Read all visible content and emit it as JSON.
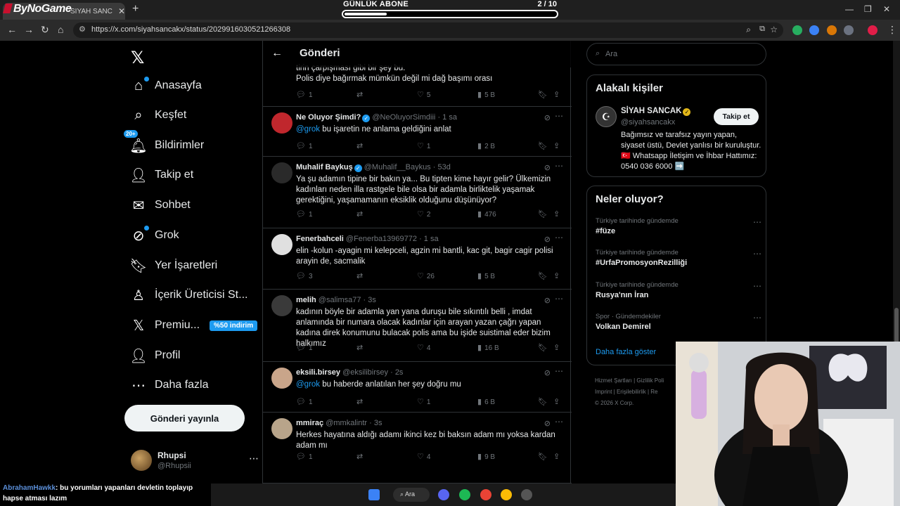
{
  "browser": {
    "logo": "ByNoGame",
    "tab_title": "SİYAH SANCAK: \"",
    "url": "https://x.com/siyahsancakx/status/2029916030521266308"
  },
  "overlay": {
    "label": "GÜNLÜK ABONE",
    "count": "2 / 10",
    "progress": 0.2
  },
  "sidebar": {
    "items": [
      {
        "label": "Anasayfa",
        "icon": "home-icon"
      },
      {
        "label": "Keşfet",
        "icon": "search-icon"
      },
      {
        "label": "Bildirimler",
        "icon": "bell-icon",
        "badge": "20+"
      },
      {
        "label": "Takip et",
        "icon": "follow-icon"
      },
      {
        "label": "Sohbet",
        "icon": "mail-icon"
      },
      {
        "label": "Grok",
        "icon": "grok-icon"
      },
      {
        "label": "Yer İşaretleri",
        "icon": "bookmark-icon"
      },
      {
        "label": "İçerik Üreticisi St...",
        "icon": "creator-icon"
      },
      {
        "label": "Premiu...",
        "icon": "x-premium-icon",
        "badge": "%50 indirim"
      },
      {
        "label": "Profil",
        "icon": "profile-icon"
      },
      {
        "label": "Daha fazla",
        "icon": "more-icon"
      }
    ],
    "post_button": "Gönderi yayınla",
    "profile": {
      "name": "Rhupsi",
      "handle": "@Rhupsii"
    }
  },
  "main": {
    "title": "Gönderi",
    "partial_text": "tirin çarpışması gibi bir şey bu.\nPolis diye bağırmak mümkün değil mi dağ başımı orası",
    "partial_stats": {
      "replies": "1",
      "likes": "5",
      "views": "5 B"
    },
    "replies": [
      {
        "name": "Ne Oluyor Şimdi?",
        "verified": true,
        "handle": "@NeOluyorSimdiii",
        "time": "1 sa",
        "mention": "@grok",
        "text": " bu işaretin ne anlama geldiğini anlat",
        "replies": "1",
        "retweets": "",
        "likes": "1",
        "views": "2 B",
        "avatar_color": "#c0272d"
      },
      {
        "name": "Muhalif Baykuş",
        "verified": true,
        "handle": "@Muhalif__Baykus",
        "time": "53d",
        "mention": "",
        "text": "Ya şu adamın tipine bir bakın ya... Bu tipten kime hayır gelir? Ülkemizin kadınları neden illa rastgele bile olsa bir adamla birliktelik yaşamak gerektiğini, yaşamamanın eksiklik olduğunu düşünüyor?",
        "replies": "1",
        "retweets": "",
        "likes": "2",
        "views": "476",
        "avatar_color": "#2a2a2a"
      },
      {
        "name": "Fenerbahceli",
        "verified": false,
        "handle": "@Fenerba13969772",
        "time": "1 sa",
        "mention": "",
        "text": "elin -kolun -ayagin mi kelepceli, agzin mi bantli, kac git, bagir cagir polisi arayin de, sacmalik",
        "replies": "3",
        "retweets": "",
        "likes": "26",
        "views": "5 B",
        "avatar_color": "#e0e0e0"
      },
      {
        "name": "melih",
        "verified": false,
        "handle": "@salimsa77",
        "time": "3s",
        "mention": "",
        "text": "kadının böyle bir  adamla yan yana duruşu bile sıkıntılı belli , imdat anlamında bir numara olacak kadınlar için arayan yazan çağrı yapan kadına direk konumunu bulacak polis ama bu işide suistimal eder bizim halkımız",
        "replies": "1",
        "retweets": "",
        "likes": "4",
        "views": "16 B",
        "avatar_color": "#3a3a3a"
      },
      {
        "name": "eksili.birsey",
        "verified": false,
        "handle": "@eksilibirsey",
        "time": "2s",
        "mention": "@grok",
        "text": " bu haberde anlatılan her şey doğru mu",
        "replies": "1",
        "retweets": "",
        "likes": "1",
        "views": "6 B",
        "avatar_color": "#c9a58a"
      },
      {
        "name": "mmiraç",
        "verified": false,
        "handle": "@mmkalintr",
        "time": "3s",
        "mention": "",
        "text": "Herkes hayatına aldığı adamı ikinci kez bi baksın adam mı yoksa kardan adam mı",
        "replies": "1",
        "retweets": "",
        "likes": "4",
        "views": "9 B",
        "avatar_color": "#b8a48a"
      }
    ]
  },
  "right": {
    "search_placeholder": "Ara",
    "related_title": "Alakalı kişiler",
    "related": {
      "name": "SİYAH SANCAK",
      "handle": "@siyahsancakx",
      "follow": "Takip et",
      "bio": "Bağımsız ve tarafsız yayın yapan, siyaset üstü, Devlet yanlısı bir kuruluştur. 🇹🇷 Whatsapp İletişim ve İhbar Hattımız: 0540 036 6000 ➡️"
    },
    "trends_title": "Neler oluyor?",
    "trends": [
      {
        "context": "Türkiye tarihinde gündemde",
        "name": "#füze"
      },
      {
        "context": "Türkiye tarihinde gündemde",
        "name": "#UrfaPromosyonRezilliği"
      },
      {
        "context": "Türkiye tarihinde gündemde",
        "name": "Rusya'nın İran"
      },
      {
        "context": "Spor · Gündemdekiler",
        "name": "Volkan Demirel"
      }
    ],
    "show_more": "Daha fazla göster",
    "footer": [
      "Hizmet Şartları  |  Gizlilik Poli",
      "Imprint  |  Erişilebilirlik  |  Re",
      "© 2026 X Corp."
    ]
  },
  "chat": {
    "user": "AbrahamHawkk",
    "message": ": bu yorumları yapanları devletin toplayıp hapse atması lazım"
  },
  "taskbar": {
    "search": "Ara"
  }
}
